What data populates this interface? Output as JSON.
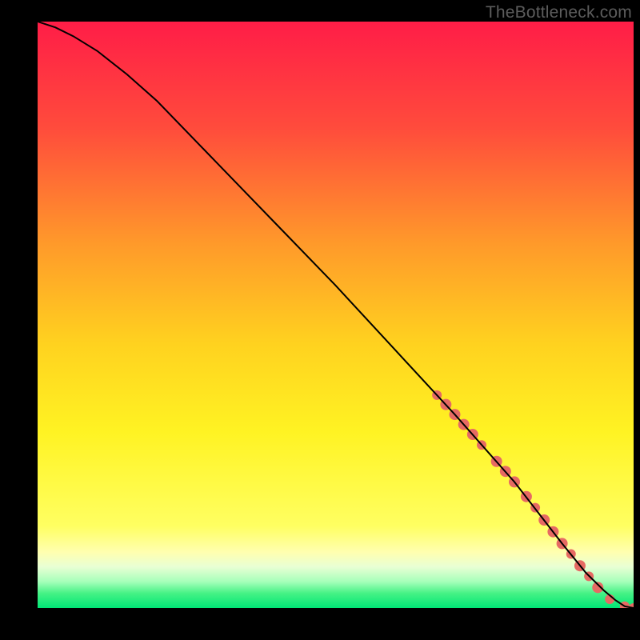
{
  "attribution": "TheBottleneck.com",
  "chart_data": {
    "type": "line",
    "title": "",
    "xlabel": "",
    "ylabel": "",
    "xlim": [
      0,
      100
    ],
    "ylim": [
      0,
      100
    ],
    "notes": "Background is a red→yellow→green vertical gradient; y value encodes bottleneck severity (high = red). A single black curve descends from top-left to bottom-right, flattening to zero near the right edge. Salmon dots/segments mark a highlighted region on the curve roughly from x≈67 to x≈100.",
    "gradient_stops": [
      {
        "pos": 0.0,
        "color": "#ff1d47"
      },
      {
        "pos": 0.18,
        "color": "#ff4b3c"
      },
      {
        "pos": 0.38,
        "color": "#ff9a2a"
      },
      {
        "pos": 0.55,
        "color": "#ffd21f"
      },
      {
        "pos": 0.7,
        "color": "#fff323"
      },
      {
        "pos": 0.86,
        "color": "#ffff61"
      },
      {
        "pos": 0.905,
        "color": "#ffffb0"
      },
      {
        "pos": 0.93,
        "color": "#e8ffd4"
      },
      {
        "pos": 0.955,
        "color": "#a6ffba"
      },
      {
        "pos": 0.975,
        "color": "#45f285"
      },
      {
        "pos": 1.0,
        "color": "#00e676"
      }
    ],
    "series": [
      {
        "name": "bottleneck-curve",
        "x": [
          0,
          3,
          6,
          10,
          15,
          20,
          30,
          40,
          50,
          60,
          70,
          80,
          88,
          92,
          95,
          97,
          98.5,
          100
        ],
        "y": [
          100,
          99,
          97.5,
          95,
          91,
          86.5,
          76,
          65.5,
          55,
          44,
          33,
          21.5,
          11,
          6,
          3,
          1.3,
          0.3,
          0
        ]
      }
    ],
    "highlight": {
      "name": "highlight-dots",
      "color": "#e66a63",
      "points": [
        {
          "x": 67,
          "y": 36.3,
          "r": 6
        },
        {
          "x": 68.5,
          "y": 34.7,
          "r": 7
        },
        {
          "x": 70,
          "y": 33.0,
          "r": 7
        },
        {
          "x": 71.5,
          "y": 31.3,
          "r": 7
        },
        {
          "x": 73,
          "y": 29.6,
          "r": 7
        },
        {
          "x": 74.5,
          "y": 27.8,
          "r": 6
        },
        {
          "x": 77,
          "y": 25.0,
          "r": 7
        },
        {
          "x": 78.5,
          "y": 23.3,
          "r": 7
        },
        {
          "x": 80,
          "y": 21.5,
          "r": 7
        },
        {
          "x": 82,
          "y": 19.0,
          "r": 7
        },
        {
          "x": 83.5,
          "y": 17.1,
          "r": 6
        },
        {
          "x": 85,
          "y": 15.0,
          "r": 7
        },
        {
          "x": 86.5,
          "y": 13.0,
          "r": 7
        },
        {
          "x": 88,
          "y": 11.0,
          "r": 7
        },
        {
          "x": 89.5,
          "y": 9.2,
          "r": 6
        },
        {
          "x": 91,
          "y": 7.2,
          "r": 7
        },
        {
          "x": 92.5,
          "y": 5.4,
          "r": 6
        },
        {
          "x": 94,
          "y": 3.5,
          "r": 7
        },
        {
          "x": 96,
          "y": 1.5,
          "r": 6
        },
        {
          "x": 98.5,
          "y": 0.3,
          "r": 6
        },
        {
          "x": 100,
          "y": 0.0,
          "r": 6
        }
      ]
    }
  }
}
